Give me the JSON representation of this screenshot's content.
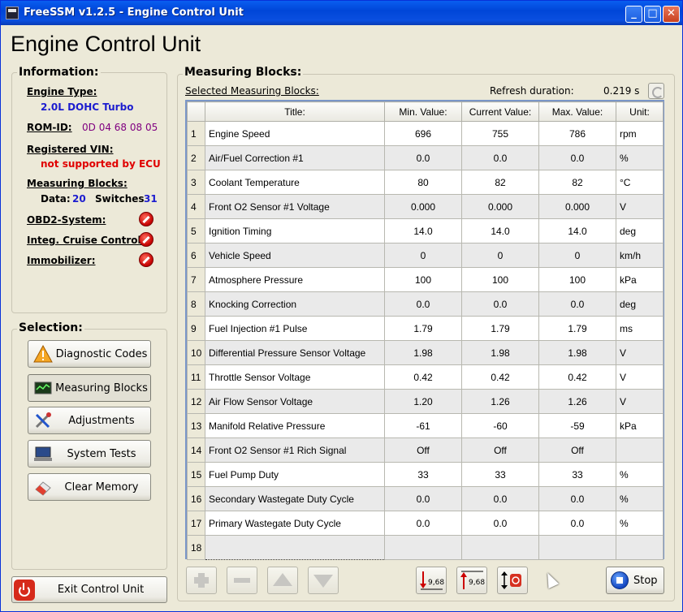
{
  "window": {
    "title": "FreeSSM v1.2.5 - Engine Control Unit"
  },
  "heading": "Engine Control Unit",
  "information": {
    "title": "Information:",
    "engine_type_label": "Engine Type:",
    "engine_type": "2.0L DOHC Turbo",
    "rom_id_label": "ROM-ID:",
    "rom_id": "0D 04 68 08 05",
    "vin_label": "Registered VIN:",
    "vin": "not supported by ECU",
    "mb_label": "Measuring Blocks:",
    "data_label": "Data:",
    "data_count": "20",
    "switches_label": "Switches",
    "switches_count": "31",
    "obd2_label": "OBD2-System:",
    "cruise_label": "Integ. Cruise Control:",
    "immobilizer_label": "Immobilizer:"
  },
  "selection": {
    "title": "Selection:",
    "buttons": [
      "Diagnostic Codes",
      "Measuring Blocks",
      "Adjustments",
      "System Tests",
      "Clear Memory"
    ]
  },
  "exit_label": "Exit Control Unit",
  "measuring": {
    "title": "Measuring Blocks:",
    "selected_label": "Selected Measuring Blocks:",
    "refresh_label": "Refresh duration:",
    "refresh_value": "0.219 s",
    "columns": [
      "Title:",
      "Min. Value:",
      "Current Value:",
      "Max. Value:",
      "Unit:"
    ],
    "rows": [
      {
        "idx": "1",
        "title": "Engine Speed",
        "min": "696",
        "cur": "755",
        "max": "786",
        "unit": "rpm"
      },
      {
        "idx": "2",
        "title": "Air/Fuel Correction #1",
        "min": "0.0",
        "cur": "0.0",
        "max": "0.0",
        "unit": "%"
      },
      {
        "idx": "3",
        "title": "Coolant Temperature",
        "min": "80",
        "cur": "82",
        "max": "82",
        "unit": "°C"
      },
      {
        "idx": "4",
        "title": "Front O2 Sensor #1 Voltage",
        "min": "0.000",
        "cur": "0.000",
        "max": "0.000",
        "unit": "V"
      },
      {
        "idx": "5",
        "title": "Ignition Timing",
        "min": "14.0",
        "cur": "14.0",
        "max": "14.0",
        "unit": "deg"
      },
      {
        "idx": "6",
        "title": "Vehicle Speed",
        "min": "0",
        "cur": "0",
        "max": "0",
        "unit": "km/h"
      },
      {
        "idx": "7",
        "title": "Atmosphere Pressure",
        "min": "100",
        "cur": "100",
        "max": "100",
        "unit": "kPa"
      },
      {
        "idx": "8",
        "title": "Knocking Correction",
        "min": "0.0",
        "cur": "0.0",
        "max": "0.0",
        "unit": "deg"
      },
      {
        "idx": "9",
        "title": "Fuel Injection #1 Pulse",
        "min": "1.79",
        "cur": "1.79",
        "max": "1.79",
        "unit": "ms"
      },
      {
        "idx": "10",
        "title": "Differential Pressure Sensor Voltage",
        "min": "1.98",
        "cur": "1.98",
        "max": "1.98",
        "unit": "V"
      },
      {
        "idx": "11",
        "title": "Throttle Sensor Voltage",
        "min": "0.42",
        "cur": "0.42",
        "max": "0.42",
        "unit": "V"
      },
      {
        "idx": "12",
        "title": "Air Flow Sensor Voltage",
        "min": "1.20",
        "cur": "1.26",
        "max": "1.26",
        "unit": "V"
      },
      {
        "idx": "13",
        "title": "Manifold Relative Pressure",
        "min": "-61",
        "cur": "-60",
        "max": "-59",
        "unit": "kPa"
      },
      {
        "idx": "14",
        "title": "Front O2 Sensor #1 Rich Signal",
        "min": "Off",
        "cur": "Off",
        "max": "Off",
        "unit": ""
      },
      {
        "idx": "15",
        "title": "Fuel Pump Duty",
        "min": "33",
        "cur": "33",
        "max": "33",
        "unit": "%"
      },
      {
        "idx": "16",
        "title": "Secondary Wastegate Duty Cycle",
        "min": "0.0",
        "cur": "0.0",
        "max": "0.0",
        "unit": "%"
      },
      {
        "idx": "17",
        "title": "Primary Wastegate Duty Cycle",
        "min": "0.0",
        "cur": "0.0",
        "max": "0.0",
        "unit": "%"
      },
      {
        "idx": "18",
        "title": "",
        "min": "",
        "cur": "",
        "max": "",
        "unit": ""
      }
    ],
    "tool_value_label": "9,68",
    "stop_label": "Stop"
  }
}
